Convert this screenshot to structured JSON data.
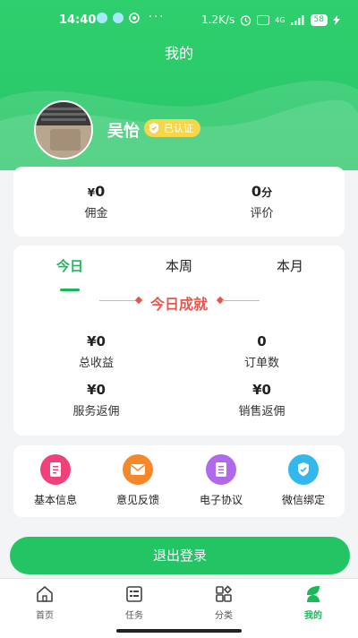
{
  "status_bar": {
    "time": "14:40",
    "more": "···",
    "speed": "1.2K/s",
    "network": "4G",
    "battery": "58"
  },
  "header": {
    "title": "我的",
    "user_name": "吴怡",
    "badge": "已认证"
  },
  "stats": [
    {
      "currency": "¥",
      "value": "0",
      "unit": "",
      "label": "佣金"
    },
    {
      "currency": "",
      "value": "0",
      "unit": "分",
      "label": "评价"
    }
  ],
  "today_card": {
    "tabs": [
      "今日",
      "本周",
      "本月"
    ],
    "active_tab": 0,
    "section_title": "今日成就",
    "metrics": [
      {
        "value": "¥0",
        "label": "总收益"
      },
      {
        "value": "0",
        "label": "订单数"
      },
      {
        "value": "¥0",
        "label": "服务返佣"
      },
      {
        "value": "¥0",
        "label": "销售返佣"
      }
    ]
  },
  "menu": [
    {
      "label": "基本信息",
      "icon": "document-icon",
      "color": "#f0417a"
    },
    {
      "label": "意见反馈",
      "icon": "mail-icon",
      "color": "#f5892a"
    },
    {
      "label": "电子协议",
      "icon": "contract-icon",
      "color": "#b169ec"
    },
    {
      "label": "微信绑定",
      "icon": "shield-check-icon",
      "color": "#33b8ee"
    }
  ],
  "logout_label": "退出登录",
  "tabbar": [
    {
      "label": "首页",
      "icon": "home-icon"
    },
    {
      "label": "任务",
      "icon": "task-list-icon"
    },
    {
      "label": "分类",
      "icon": "category-icon"
    },
    {
      "label": "我的",
      "icon": "profile-icon"
    }
  ],
  "colors": {
    "brand": "#22c464",
    "accent_red": "#e8574d",
    "badge": "#f6d64a"
  }
}
